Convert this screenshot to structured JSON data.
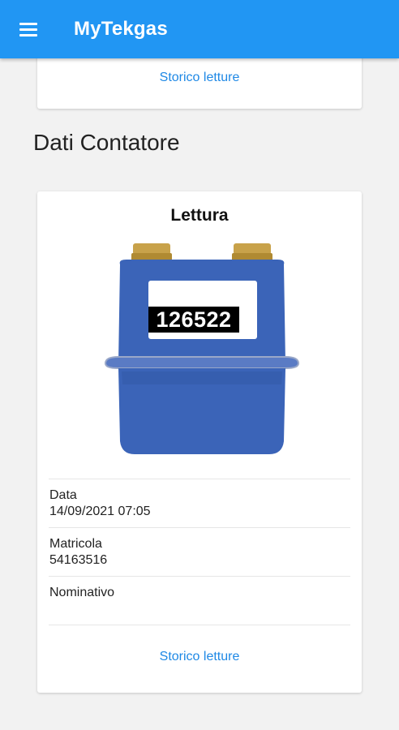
{
  "appbar": {
    "title": "MyTekgas",
    "menu_icon": "menu-icon"
  },
  "top_card": {
    "link_label": "Storico letture"
  },
  "section": {
    "title": "Dati Contatore"
  },
  "meter_card": {
    "heading": "Lettura",
    "reading": "126522",
    "meter_color": "#3b64b8",
    "fields": [
      {
        "label": "Data",
        "value": "14/09/2021 07:05"
      },
      {
        "label": "Matricola",
        "value": "54163516"
      },
      {
        "label": "Nominativo",
        "value": ""
      }
    ],
    "link_label": "Storico letture"
  },
  "colors": {
    "accent": "#2196f3",
    "link": "#1e88e5",
    "background": "#f2f2f2"
  }
}
